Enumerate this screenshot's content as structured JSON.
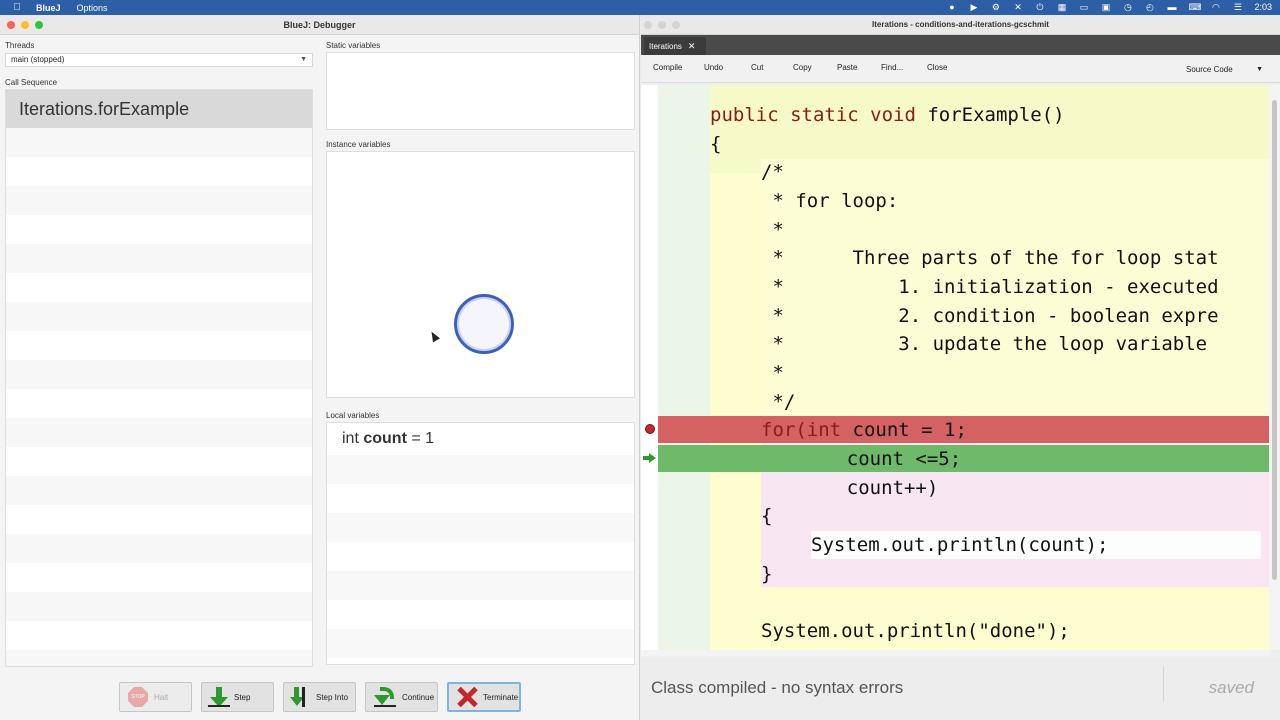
{
  "menubar": {
    "app": "BlueJ",
    "menus": [
      "Options"
    ],
    "clock": "2:03"
  },
  "debugger": {
    "title": "BlueJ: Debugger",
    "threads_label": "Threads",
    "thread_selected": "main (stopped)",
    "callseq_label": "Call Sequence",
    "callseq_items": [
      "Iterations.forExample"
    ],
    "static_label": "Static variables",
    "instance_label": "Instance variables",
    "local_label": "Local variables",
    "local_vars": [
      {
        "type": "int",
        "name": "count",
        "value": "= 1"
      }
    ],
    "buttons": {
      "halt": "Halt",
      "halt_icon_text": "STOP",
      "step": "Step",
      "step_into": "Step Into",
      "continue": "Continue",
      "terminate": "Terminate"
    }
  },
  "editor": {
    "title": "Iterations - conditions-and-iterations-gcschmit",
    "tab": "Iterations",
    "toolbar": [
      "Compile",
      "Undo",
      "Cut",
      "Copy",
      "Paste",
      "Find...",
      "Close"
    ],
    "view_mode": "Source Code",
    "code": {
      "l1_kw": "public static void",
      "l1_rest": " forExample()",
      "l2": "{",
      "c1": "/*",
      "c2": " * for loop:",
      "c3": " *",
      "c4": " *      Three parts of the for loop stat",
      "c5": " *          1. initialization - executed",
      "c6": " *          2. condition - boolean expre",
      "c7": " *          3. update the loop variable",
      "c8": " *",
      "c9": " */",
      "f1_a": "for(",
      "f1_kw": "int",
      "f1_b": " count = 1;",
      "f2": "    count <=5;",
      "f3": "    count++)",
      "b1": "{",
      "b2": "System.out.println(count);",
      "b3": "}",
      "done": "System.out.println(\"done\");"
    },
    "status": "Class compiled - no syntax errors",
    "saved": "saved"
  },
  "colors": {
    "breakpoint_line": "#d46263",
    "exec_line": "#6fb96a",
    "keyword": "#8b1a1a"
  }
}
